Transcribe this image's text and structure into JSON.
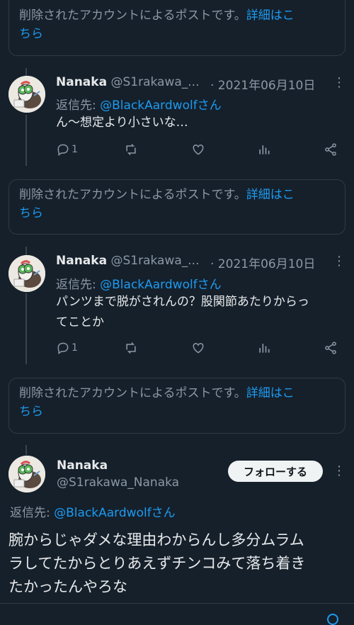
{
  "deleted_notice": {
    "text": "削除されたアカウントによるポストです。",
    "link_label_1": "詳細はこ",
    "link_label_2": "ちら"
  },
  "tweets": [
    {
      "name": "Nanaka",
      "handle": "@S1rakawa_...",
      "date": "· 2021年06月10日",
      "reply_prefix": "返信先: ",
      "reply_to": "@BlackAardwolfさん",
      "text_lines": [
        "ん〜想定より小さいな…"
      ],
      "reply_count": "1"
    },
    {
      "name": "Nanaka",
      "handle": "@S1rakawa_...",
      "date": "· 2021年06月10日",
      "reply_prefix": "返信先: ",
      "reply_to": "@BlackAardwolfさん",
      "text_lines": [
        "パンツまで脱がされんの？股関節あたりからっ",
        "てことか"
      ],
      "reply_count": "1"
    }
  ],
  "main_tweet": {
    "name": "Nanaka",
    "handle": "@S1rakawa_Nanaka",
    "follow_label": "フォローする",
    "reply_prefix": "返信先: ",
    "reply_to": "@BlackAardwolfさん",
    "text_lines": [
      "腕からじゃダメな理由わからんし多分ムラム",
      "ラしてたからとりあえずチンコみて落ち着き",
      "たかったんやろな"
    ]
  },
  "icons": {
    "more": "more-dots-icon",
    "reply": "reply-icon",
    "retweet": "retweet-icon",
    "like": "heart-icon",
    "views": "views-icon",
    "share": "share-icon"
  },
  "colors": {
    "background": "#15202b",
    "text": "#e7e9ea",
    "muted": "#8b98a5",
    "link": "#1d9bf0",
    "border": "#2f3a45"
  }
}
